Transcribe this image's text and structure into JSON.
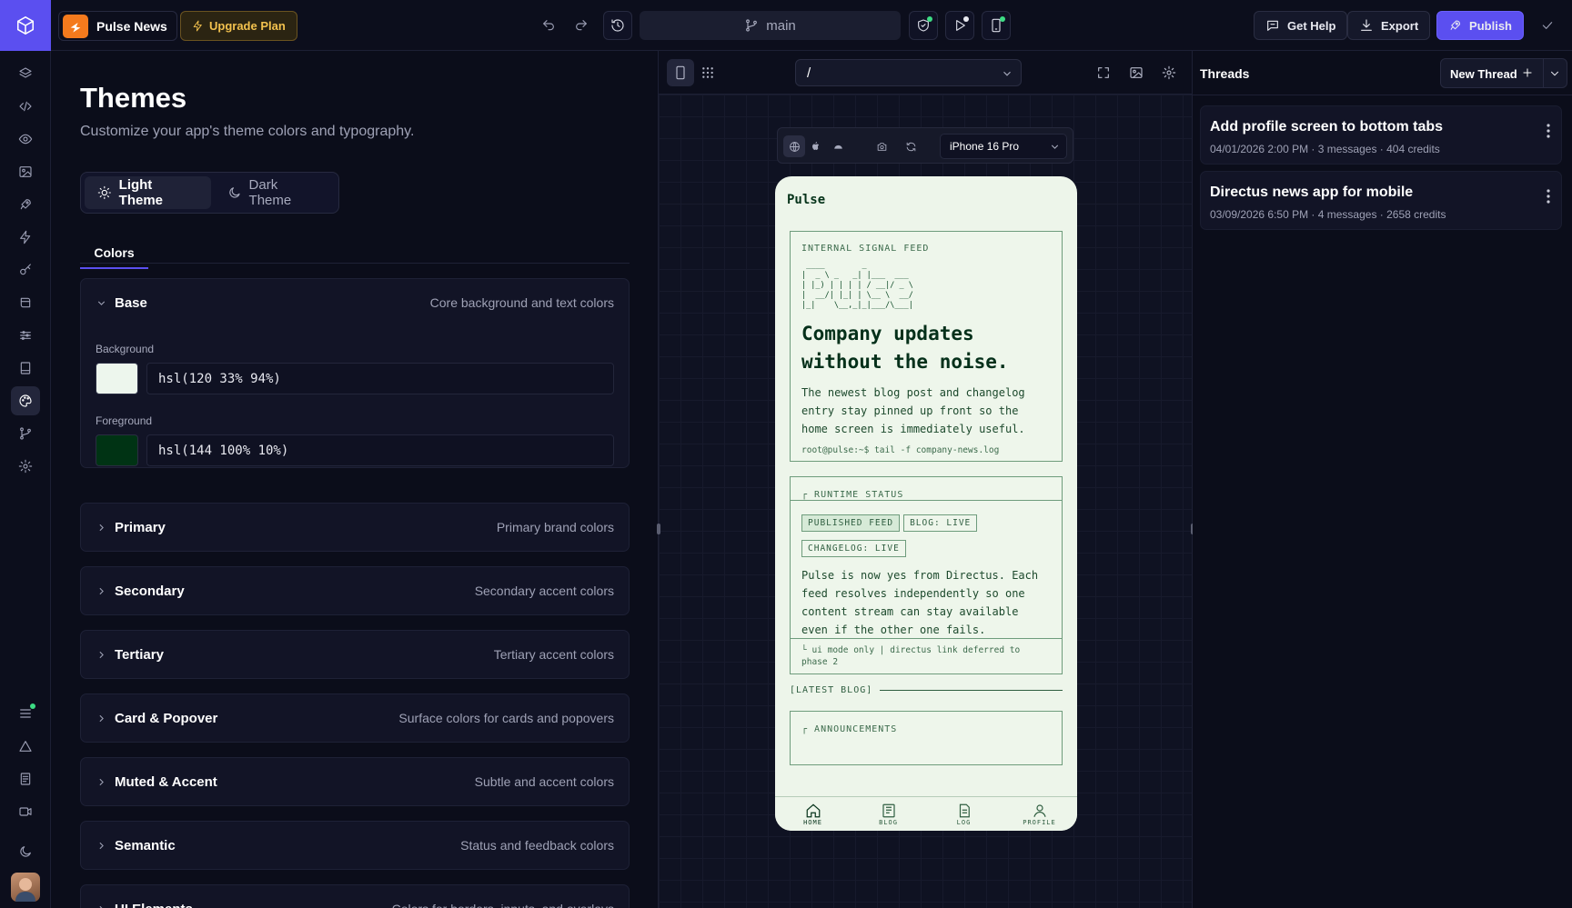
{
  "topbar": {
    "project_name": "Pulse News",
    "upgrade_label": "Upgrade Plan",
    "branch": "main",
    "help_label": "Get Help",
    "export_label": "Export",
    "publish_label": "Publish"
  },
  "themes": {
    "title": "Themes",
    "subtitle": "Customize your app's theme colors and typography.",
    "light_label": "Light Theme",
    "dark_label": "Dark Theme",
    "tab_colors": "Colors",
    "base": {
      "title": "Base",
      "description": "Core background and text colors",
      "background_label": "Background",
      "background_value": "hsl(120 33% 94%)",
      "background_color": "#edf6ed",
      "foreground_label": "Foreground",
      "foreground_value": "hsl(144 100% 10%)",
      "foreground_color": "#003314"
    },
    "sections": [
      {
        "title": "Primary",
        "description": "Primary brand colors"
      },
      {
        "title": "Secondary",
        "description": "Secondary accent colors"
      },
      {
        "title": "Tertiary",
        "description": "Tertiary accent colors"
      },
      {
        "title": "Card & Popover",
        "description": "Surface colors for cards and popovers"
      },
      {
        "title": "Muted & Accent",
        "description": "Subtle and accent colors"
      },
      {
        "title": "Semantic",
        "description": "Status and feedback colors"
      },
      {
        "title": "UI Elements",
        "description": "Colors for borders, inputs, and overlays"
      }
    ]
  },
  "preview": {
    "route": "/",
    "device": "iPhone 16 Pro",
    "app": {
      "header": "Pulse",
      "feed_label": "INTERNAL SIGNAL FEED",
      "ascii_art": " ____        _\n|  _ \\ _   _| |___  ___\n| |_) | | | | / __|/ _ \\\n|  __/| |_| | \\__ \\  __/\n|_|    \\__,_|_|___/\\___|",
      "headline": "Company updates without the noise.",
      "intro": "The newest blog post and changelog entry stay pinned up front so the home screen is immediately useful.",
      "prompt": "root@pulse:~$ tail -f company-news.log",
      "runtime_label": "RUNTIME STATUS",
      "tags": [
        "PUBLISHED FEED",
        "BLOG: LIVE",
        "CHANGELOG: LIVE"
      ],
      "runtime_text": "Pulse is now yes from Directus. Each feed resolves independently so one content stream can stay available even if the other one fails.",
      "runtime_footer": "└ ui mode only | directus link deferred to phase 2",
      "latest_blog": "[LATEST BLOG]",
      "announcements": "ANNOUNCEMENTS",
      "tabs": [
        "HOME",
        "BLOG",
        "LOG",
        "PROFILE"
      ]
    }
  },
  "threads": {
    "title": "Threads",
    "new_label": "New Thread",
    "items": [
      {
        "title": "Add profile screen to bottom tabs",
        "meta": "04/01/2026 2:00 PM · 3 messages · 404 credits"
      },
      {
        "title": "Directus news app for mobile",
        "meta": "03/09/2026 6:50 PM · 4 messages · 2658 credits"
      }
    ]
  },
  "icons": {
    "topbar": [
      "cube-logo-icon",
      "project-logo-icon",
      "bolt-icon",
      "undo-icon",
      "redo-icon",
      "history-icon",
      "git-branch-icon",
      "shield-check-icon",
      "play-icon",
      "smartphone-icon",
      "chat-help-icon",
      "download-icon",
      "rocket-icon",
      "check-icon"
    ],
    "rail": [
      "layers-icon",
      "code-icon",
      "eye-icon",
      "image-icon",
      "rocket-icon",
      "bolt-icon",
      "key-icon",
      "database-icon",
      "sliders-icon",
      "book-icon",
      "palette-icon",
      "git-branch-icon",
      "gear-icon",
      "server-icon",
      "warning-icon",
      "document-icon",
      "video-icon",
      "moon-icon"
    ]
  }
}
